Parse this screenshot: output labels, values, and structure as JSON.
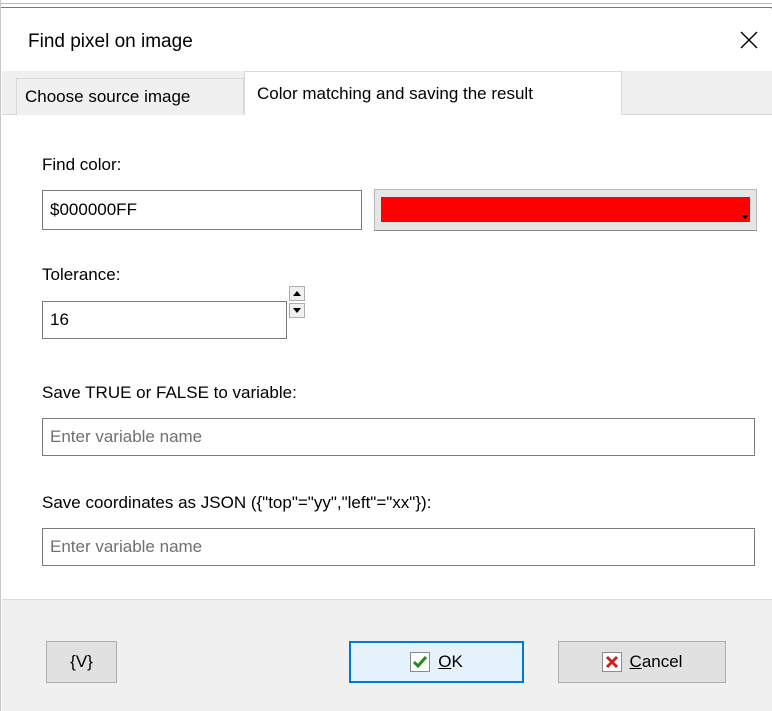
{
  "window": {
    "title": "Find pixel on image",
    "close_glyph": "✕"
  },
  "tabs": [
    {
      "label": "Choose source image",
      "active": false
    },
    {
      "label": "Color matching and saving the result",
      "active": true
    }
  ],
  "find_color": {
    "label": "Find color:",
    "value": "$000000FF",
    "swatch_color": "#ff0000"
  },
  "tolerance": {
    "label": "Tolerance:",
    "value": "16"
  },
  "save_bool": {
    "label": "Save TRUE or FALSE to variable:",
    "placeholder": "Enter variable name"
  },
  "save_coords": {
    "label": "Save coordinates as JSON ({\"top\"=\"yy\",\"left\"=\"xx\"}):",
    "placeholder": "Enter variable name"
  },
  "buttons": {
    "variables": "{V}",
    "ok_mnemonic": "O",
    "ok_rest": "K",
    "cancel_mnemonic": "C",
    "cancel_rest": "ancel"
  },
  "icons": {
    "ok": "checkmark-icon",
    "cancel": "x-icon",
    "close": "close-icon"
  },
  "colors": {
    "ok_check": "#1e8c1e",
    "cancel_x": "#d02020",
    "default_button_border": "#0078d7"
  }
}
